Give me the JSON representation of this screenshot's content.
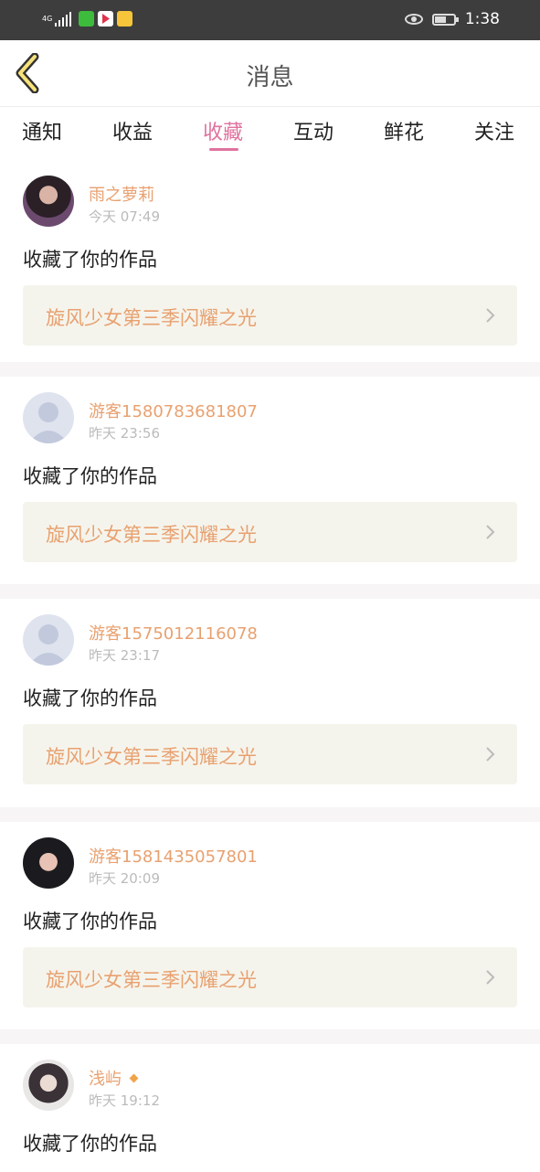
{
  "status_bar": {
    "network": "4G",
    "time": "1:38",
    "icons": [
      "signal-icon",
      "app-icon-green",
      "app-icon-video",
      "app-icon-yellow",
      "eye-icon",
      "battery-icon"
    ]
  },
  "header": {
    "title": "消息",
    "back_icon": "chevron-left-icon"
  },
  "tabs": [
    {
      "label": "通知",
      "active": false
    },
    {
      "label": "收益",
      "active": false
    },
    {
      "label": "收藏",
      "active": true
    },
    {
      "label": "互动",
      "active": false
    },
    {
      "label": "鲜花",
      "active": false
    },
    {
      "label": "关注",
      "active": false
    }
  ],
  "messages": [
    {
      "user": "雨之萝莉",
      "time": "今天 07:49",
      "action": "收藏了你的作品",
      "work": "旋风少女第三季闪耀之光",
      "avatar": "photo"
    },
    {
      "user": "游客1580783681807",
      "time": "昨天 23:56",
      "action": "收藏了你的作品",
      "work": "旋风少女第三季闪耀之光",
      "avatar": "default"
    },
    {
      "user": "游客1575012116078",
      "time": "昨天 23:17",
      "action": "收藏了你的作品",
      "work": "旋风少女第三季闪耀之光",
      "avatar": "default"
    },
    {
      "user": "游客1581435057801",
      "time": "昨天 20:09",
      "action": "收藏了你的作品",
      "work": "旋风少女第三季闪耀之光",
      "avatar": "photo"
    },
    {
      "user": "浅屿",
      "time": "昨天 19:12",
      "action": "收藏了你的作品",
      "work": "",
      "avatar": "photo",
      "vip": true
    }
  ],
  "colors": {
    "accent": "#e0729e",
    "username": "#e8a170",
    "card_bg": "#f5f4ec",
    "status_bar": "#3d3d3d",
    "vip_badge": "#f0a44a"
  }
}
